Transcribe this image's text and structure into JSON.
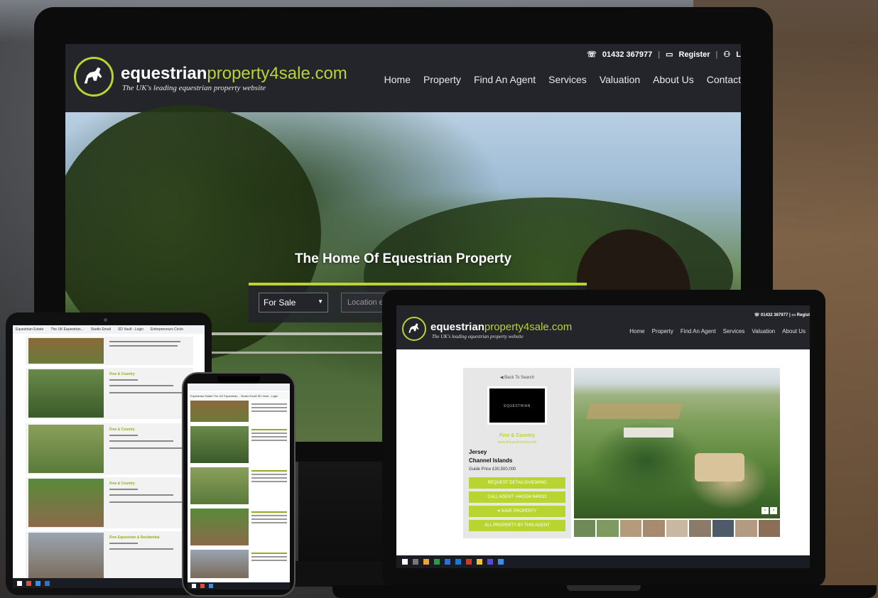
{
  "brand": {
    "name_bold": "equestrian",
    "name_rest": "property4sale.com",
    "tagline": "The UK's leading equestrian property website",
    "accent_color": "#b7d433",
    "header_color": "#23252b"
  },
  "desktop": {
    "phone": "01432 367977",
    "register_label": "Register",
    "login_label": "L",
    "nav": [
      "Home",
      "Property",
      "Find An Agent",
      "Services",
      "Valuation",
      "About Us",
      "Contact"
    ],
    "hero_title": "The Home Of Equestrian Property",
    "search_select": "For Sale",
    "search_placeholder": "Location e.g."
  },
  "laptop": {
    "phone": "01432 367977",
    "register_label": "Regist",
    "nav": [
      "Home",
      "Property",
      "Find An Agent",
      "Services",
      "Valuation",
      "About Us"
    ],
    "back_label": "Back To Search",
    "agent_logo_text": "EQUESTRIAN",
    "agent_name": "Fine & Country",
    "agent_url": "www.fineandcountry.com",
    "location_line1": "Jersey",
    "location_line2": "Channel Islands",
    "price": "Guide Price £30,500,000",
    "buttons": [
      "REQUEST DETAILS/VIEWING",
      "CALL AGENT +441534 840022",
      "SAVE PROPERTY",
      "ALL PROPERTY BY THIS AGENT"
    ]
  },
  "tablet": {
    "bookmarks": [
      "Equestrian Estate",
      "The UK Equestrian...",
      "Studio Email",
      "SD Vault - Login",
      "Entrepreneurs Circle"
    ],
    "listings": [
      {
        "title": ""
      },
      {
        "title": "Fine & Country"
      },
      {
        "title": "Fine & Country"
      },
      {
        "title": "Fine & Country"
      },
      {
        "title": "Fine Equestrian & Residential"
      }
    ]
  },
  "phone": {
    "bookmarks": [
      "Equestrian Estate",
      "The UK Equestrian...",
      "Studio Email",
      "SD Vault - Login"
    ]
  }
}
